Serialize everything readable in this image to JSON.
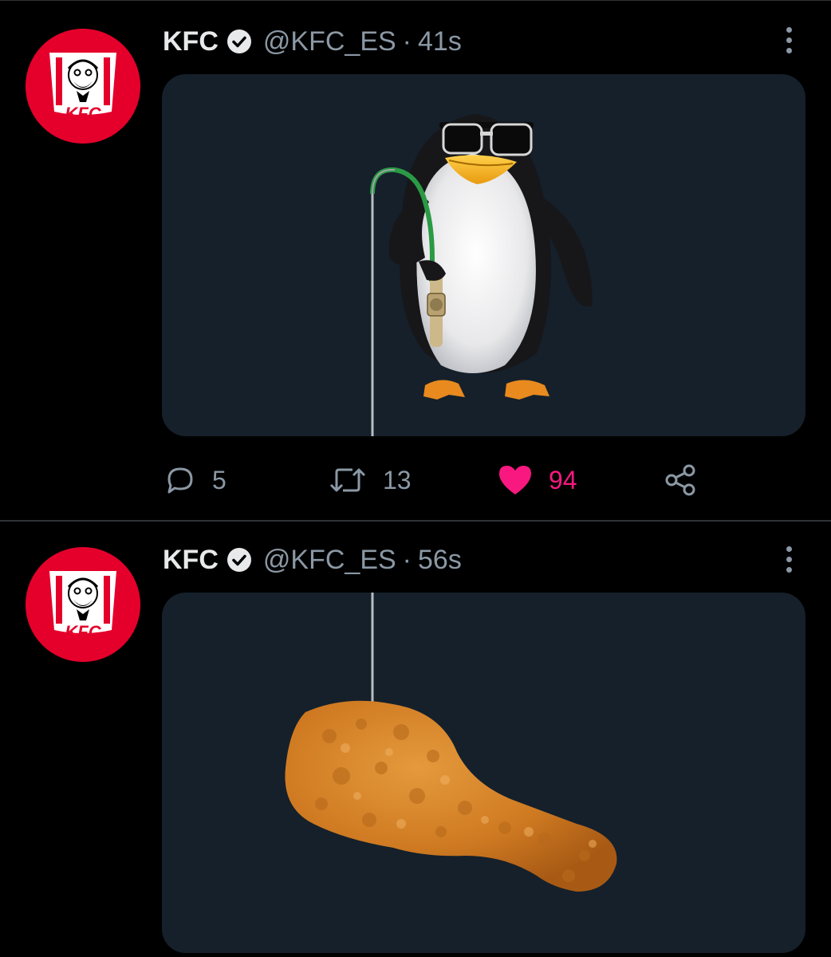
{
  "tweets": [
    {
      "display_name": "KFC",
      "verified": true,
      "handle": "@KFC_ES",
      "separator": "·",
      "time": "41s",
      "avatar_text": "KFC",
      "media": "penguin-with-fishing-rod",
      "actions": {
        "replies": "5",
        "retweets": "13",
        "likes": "94",
        "liked": true
      }
    },
    {
      "display_name": "KFC",
      "verified": true,
      "handle": "@KFC_ES",
      "separator": "·",
      "time": "56s",
      "avatar_text": "KFC",
      "media": "fried-chicken-drumstick-on-line"
    }
  ],
  "colors": {
    "background": "#000000",
    "media_background": "#15202b",
    "kfc_red": "#e4002b",
    "like_pink": "#f91880",
    "secondary_text": "#8b98a5"
  }
}
